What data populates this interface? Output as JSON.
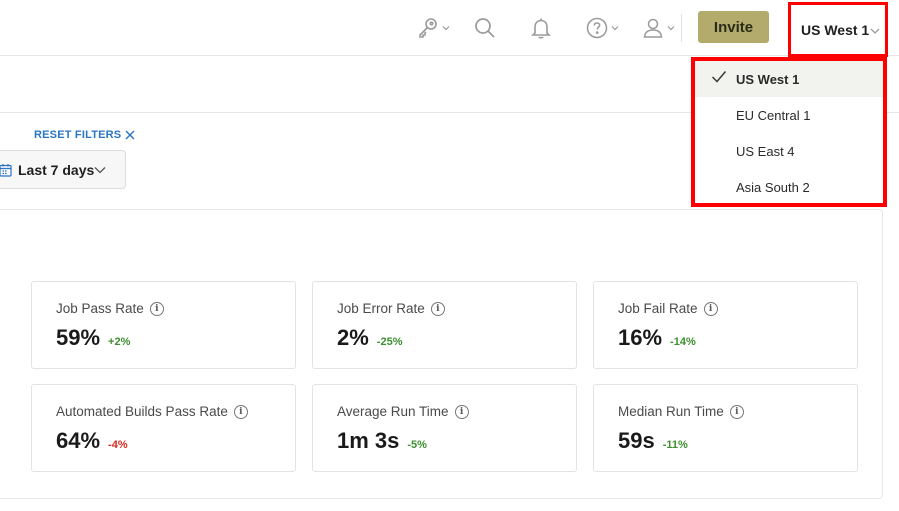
{
  "topbar": {
    "icons": [
      "key-icon",
      "search-icon",
      "bell-icon",
      "help-icon",
      "user-icon"
    ],
    "invite_label": "Invite",
    "region_label": "US West 1"
  },
  "filters": {
    "reset_label": "RESET FILTERS",
    "date_range_label": "Last 7 days"
  },
  "metrics": [
    {
      "label": "Job Pass Rate",
      "value": "59%",
      "delta": "+2%"
    },
    {
      "label": "Job Error Rate",
      "value": "2%",
      "delta": "-25%"
    },
    {
      "label": "Job Fail Rate",
      "value": "16%",
      "delta": "-14%"
    },
    {
      "label": "Automated Builds Pass Rate",
      "value": "64%",
      "delta": "-4%"
    },
    {
      "label": "Average Run Time",
      "value": "1m 3s",
      "delta": "-5%"
    },
    {
      "label": "Median Run Time",
      "value": "59s",
      "delta": "-11%"
    }
  ],
  "region_dropdown": {
    "options": [
      {
        "label": "US West 1",
        "selected": true
      },
      {
        "label": "EU Central 1",
        "selected": false
      },
      {
        "label": "US East 4",
        "selected": false
      },
      {
        "label": "Asia South 2",
        "selected": false
      }
    ]
  },
  "colors": {
    "invite_bg": "#b2ab6b",
    "highlight_border": "#ff0000",
    "positive": "#3d8f2f",
    "negative": "#d62a20",
    "link": "#2a76c4"
  }
}
